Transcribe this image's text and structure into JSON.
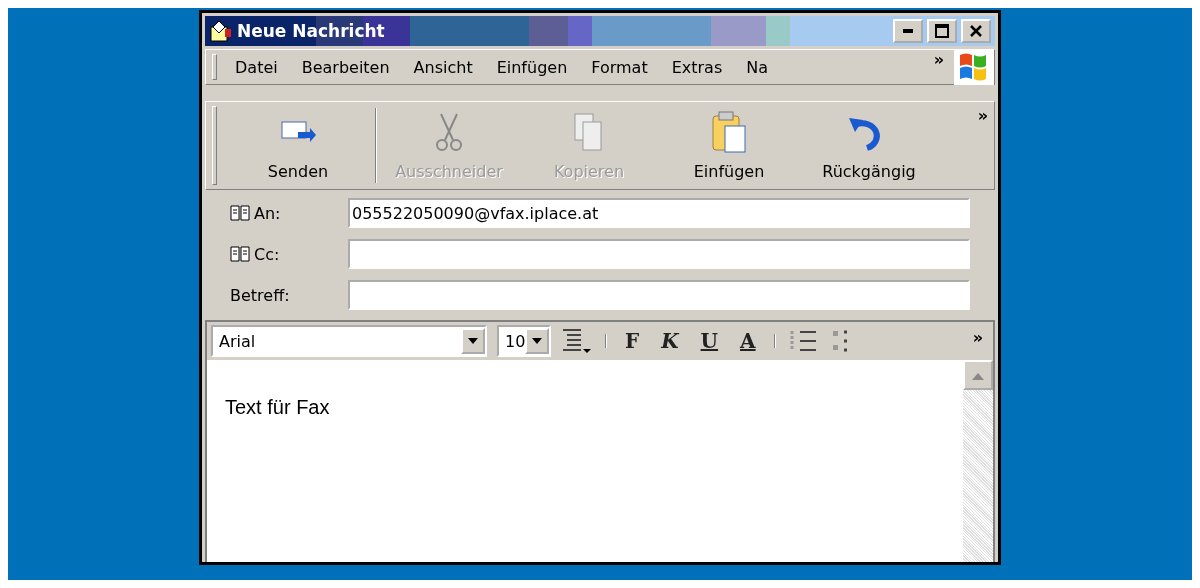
{
  "window": {
    "title": "Neue Nachricht"
  },
  "menu": [
    {
      "label": "Datei"
    },
    {
      "label": "Bearbeiten"
    },
    {
      "label": "Ansicht"
    },
    {
      "label": "Einfügen"
    },
    {
      "label": "Format"
    },
    {
      "label": "Extras"
    },
    {
      "label": "Na"
    }
  ],
  "menu_more": "»",
  "toolbar": [
    {
      "label": "Senden",
      "kind": "send",
      "disabled": false
    },
    {
      "label": "Ausschneider",
      "kind": "cut",
      "disabled": true
    },
    {
      "label": "Kopieren",
      "kind": "copy",
      "disabled": true
    },
    {
      "label": "Einfügen",
      "kind": "paste",
      "disabled": false
    },
    {
      "label": "Rückgängig",
      "kind": "undo",
      "disabled": false
    }
  ],
  "toolbar_more": "»",
  "fields": [
    {
      "label": "An:",
      "book": true,
      "value": "055522050090@vfax.iplace.at"
    },
    {
      "label": "Cc:",
      "book": true
    },
    {
      "label": "Betreff:",
      "book": false
    }
  ],
  "format": {
    "font": "Arial",
    "size": "10",
    "bold": "F",
    "italic": "K",
    "underline": "U",
    "font_color": "A",
    "more": "»"
  },
  "body": {
    "text": "Text für Fax"
  }
}
